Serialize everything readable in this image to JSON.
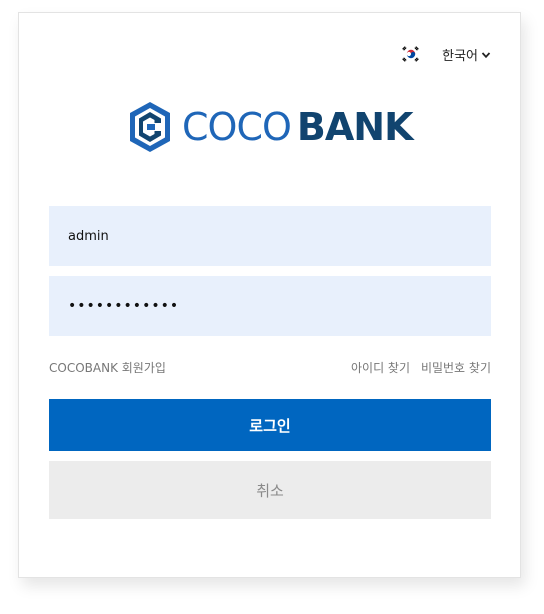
{
  "language": {
    "selected": "한국어",
    "flag_icon": "south-korea-flag-icon",
    "dropdown_icon": "chevron-down-icon"
  },
  "brand": {
    "logo_icon": "cocobank-c-shield-logo",
    "name_part1": "COCO",
    "name_part2": "BANK",
    "primary_color": "#1f66b8",
    "dark_color": "#11446f"
  },
  "login_form": {
    "username_value": "admin",
    "password_value": "••••••••••••",
    "signup_link": "COCOBANK 회원가입",
    "find_id_link": "아이디 찾기",
    "find_password_link": "비밀번호 찾기",
    "login_button": "로그인",
    "cancel_button": "취소",
    "login_button_color": "#0066c0",
    "input_bg_color": "#e8f0fc"
  }
}
